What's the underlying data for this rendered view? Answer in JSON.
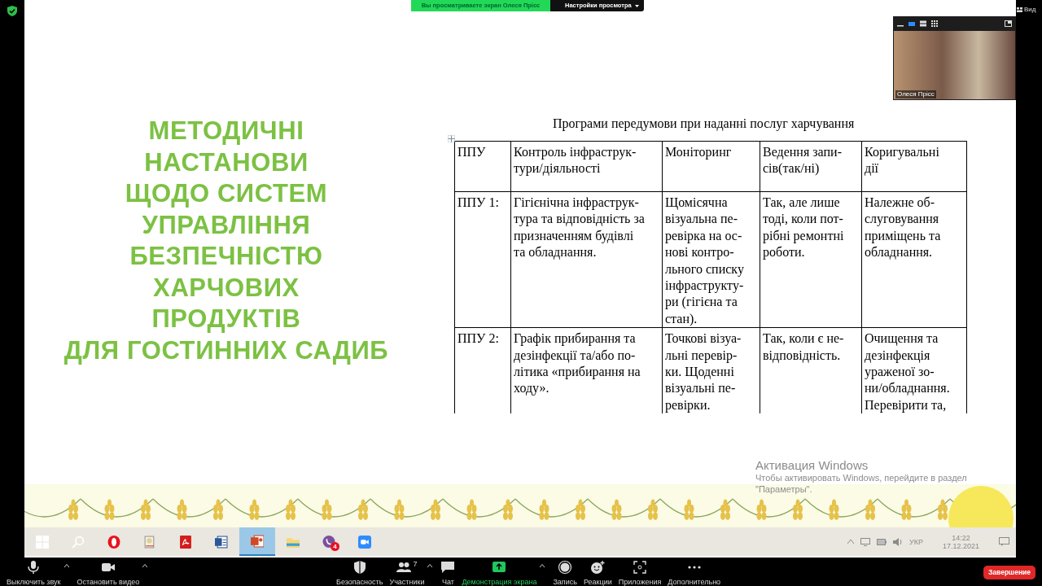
{
  "share_banner": {
    "status": "Вы просматриваете экран Олеся Прісс",
    "view_options": "Настройки просмотра"
  },
  "view_button": "Вид",
  "video_tile": {
    "participant": "Олеся Прісс",
    "layouts": [
      {
        "kind": "speaker",
        "selected": true
      },
      {
        "kind": "strip",
        "selected": false
      },
      {
        "kind": "grid",
        "selected": false
      }
    ]
  },
  "slide": {
    "title_lines": [
      "МЕТОДИЧНІ",
      "НАСТАНОВИ",
      "ЩОДО СИСТЕМ",
      "УПРАВЛІННЯ",
      "БЕЗПЕЧНІСТЮ",
      "ХАРЧОВИХ",
      "ПРОДУКТІВ",
      "ДЛЯ ГОСТИННИХ САДИБ"
    ],
    "table_title": "Програми передумови при наданні послуг харчування",
    "columns": [
      "ППУ",
      "Контроль інфраструк-\nтури/діяльності",
      "Моніторинг",
      "Ведення запи-\nсів(так/ні)",
      "Коригувальні\nдії"
    ],
    "rows": [
      {
        "cells": [
          "ППУ 1:",
          "Гігієнічна інфраструк-\nтура та відповідність за\nпризначенням будівлі\nта обладнання.",
          "Щомісячна\nвізуальна пе-\nревірка на ос-\nнові контро-\nльного списку\nінфраструкту-\nри (гігієна та\nстан).",
          "Так, але лише\nтоді, коли пот-\nрібні ремонтні\nроботи.",
          "Належне об-\nслуговування\nприміщень та\nобладнання."
        ]
      },
      {
        "cells": [
          "ППУ 2:",
          "Графік прибирання та\nдезінфекції та/або по-\nлітика «прибирання на\nходу».",
          "Точкові візуа-\nльні перевір-\nки. Щоденні\nвізуальні пе-\nревірки.",
          "Так, коли є не-\nвідповідність.",
          "Очищення та\nдезінфекція\nураженої зо-\nни/обладнання.\nПеревірити та,"
        ]
      }
    ]
  },
  "windows_activation": {
    "title": "Активация Windows",
    "hint": "Чтобы активировать Windows, перейдите в раздел \"Параметры\"."
  },
  "taskbar": {
    "apps": [
      {
        "kind": "start",
        "selected": false
      },
      {
        "kind": "search",
        "selected": false
      },
      {
        "kind": "opera",
        "selected": false
      },
      {
        "kind": "pdf-tool",
        "selected": false
      },
      {
        "kind": "acrobat",
        "selected": false
      },
      {
        "kind": "word",
        "selected": false
      },
      {
        "kind": "powerpoint",
        "selected": true
      },
      {
        "kind": "explorer",
        "selected": false
      },
      {
        "kind": "viber",
        "selected": false,
        "badge": "4"
      },
      {
        "kind": "zoom",
        "selected": false
      }
    ],
    "language": "УКР",
    "time": "14:22",
    "date": "17.12.2021"
  },
  "toolbar": {
    "left_items": [
      {
        "kind": "mic",
        "label": "Выключить звук",
        "caret": true,
        "active": false
      },
      {
        "kind": "video",
        "label": "Остановить видео",
        "caret": true,
        "active": false
      }
    ],
    "center_items": [
      {
        "kind": "security",
        "label": "Безопасность",
        "caret": false,
        "active": false
      },
      {
        "kind": "participants",
        "label": "Участники",
        "count": "7",
        "caret": true,
        "active": false
      },
      {
        "kind": "chat",
        "label": "Чат",
        "caret": false,
        "active": false
      },
      {
        "kind": "share",
        "label": "Демонстрация экрана",
        "caret": true,
        "active": true
      },
      {
        "kind": "record",
        "label": "Запись",
        "caret": false,
        "active": false
      },
      {
        "kind": "reactions",
        "label": "Реакции",
        "caret": false,
        "active": false
      },
      {
        "kind": "apps",
        "label": "Приложения",
        "caret": false,
        "active": false
      },
      {
        "kind": "more",
        "label": "Дополнительно",
        "caret": false,
        "active": false
      }
    ],
    "end_button": "Завершение"
  }
}
